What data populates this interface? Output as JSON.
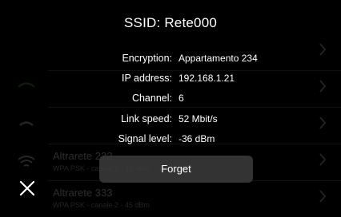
{
  "dialog": {
    "title": "SSID: Rete000",
    "info": [
      {
        "label": "Encryption:",
        "value": "Appartamento 234"
      },
      {
        "label": "IP address:",
        "value": "192.168.1.21"
      },
      {
        "label": "Channel:",
        "value": "6"
      },
      {
        "label": "Link speed:",
        "value": "52 Mbit/s"
      },
      {
        "label": "Signal level:",
        "value": "-36 dBm"
      }
    ],
    "forget_label": "Forget",
    "close_icon": "close-icon"
  },
  "background_list": {
    "items": [
      {
        "name": "Altrarete 222",
        "sub": "WPA PSK - canale 2 - 42 dBm"
      },
      {
        "name": "Altrarete 333",
        "sub": "WPA PSK - canale 2 - 45 dBm"
      }
    ],
    "icons": [
      "wifi-icon",
      "chevron-right-icon"
    ],
    "colors": {
      "accent": "#3a8a2f"
    }
  }
}
